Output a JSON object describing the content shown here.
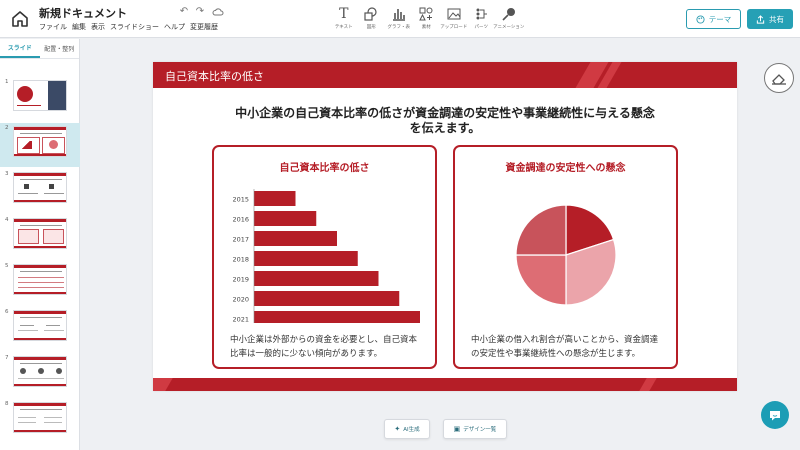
{
  "app": {
    "title": "新規ドキュメント",
    "menus": [
      "ファイル",
      "編集",
      "表示",
      "スライドショー",
      "ヘルプ",
      "変更履歴"
    ]
  },
  "toolbar": {
    "tools": [
      {
        "label": "テキスト",
        "icon": "text-icon"
      },
      {
        "label": "図形",
        "icon": "shapes-icon"
      },
      {
        "label": "グラフ・表",
        "icon": "chart-icon"
      },
      {
        "label": "素材",
        "icon": "elements-icon"
      },
      {
        "label": "アップロード",
        "icon": "upload-icon"
      },
      {
        "label": "パーツ",
        "icon": "parts-icon"
      },
      {
        "label": "アニメーション",
        "icon": "animation-icon"
      }
    ],
    "theme_label": "テーマ",
    "share_label": "共有"
  },
  "sidebar": {
    "tabs": [
      "スライド",
      "配置・整列"
    ],
    "thumbnails": [
      "1",
      "2",
      "3",
      "4",
      "5",
      "6",
      "7",
      "8"
    ],
    "selected_index": 2
  },
  "slide": {
    "header_title": "自己資本比率の低さ",
    "headline_line1": "中小企業の自己資本比率の低さが資金調達の安定性や事業継続性に与える懸念",
    "headline_line2": "を伝えます。",
    "left_card": {
      "title": "自己資本比率の低さ",
      "text": "中小企業は外部からの資金を必要とし、自己資本比率は一般的に少ない傾向があります。"
    },
    "right_card": {
      "title": "資金調達の安定性への懸念",
      "text": "中小企業の借入れ割合が高いことから、資金調達の安定性や事業継続性への懸念が生じます。"
    }
  },
  "bottom": {
    "ai_label": "AI生成",
    "design_label": "デザイン一覧"
  },
  "colors": {
    "accent": "#2a9bb0",
    "slide_red": "#b51e27"
  },
  "chart_data": [
    {
      "type": "bar",
      "orientation": "horizontal",
      "categories": [
        "2015",
        "2016",
        "2017",
        "2018",
        "2019",
        "2020",
        "2021"
      ],
      "values": [
        2,
        3,
        4,
        5,
        6,
        7,
        8
      ],
      "color": "#b51e27"
    },
    {
      "type": "pie",
      "values": [
        20,
        30,
        25,
        25
      ],
      "colors": [
        "#b51e27",
        "#eba4aa",
        "#dd6d74",
        "#c8535b"
      ]
    }
  ]
}
